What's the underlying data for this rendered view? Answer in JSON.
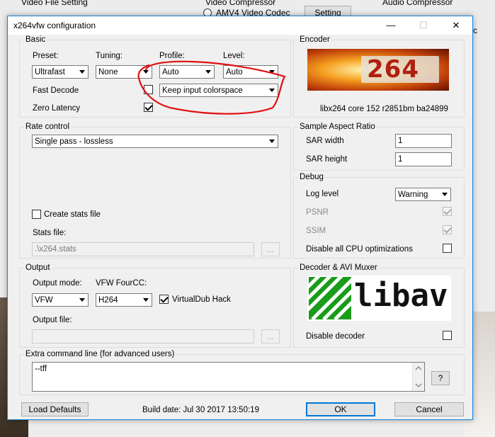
{
  "background": {
    "snippet_1": "Video File Setting",
    "snippet_2": "Video Compressor",
    "snippet_3": "AMV4 Video Codec",
    "snippet_4": "Setting",
    "snippet_5": "Audio Compressor",
    "snippet_6": "c"
  },
  "window": {
    "title": "x264vfw configuration",
    "minimize": "—",
    "maximize": "☐",
    "close": "✕"
  },
  "basic": {
    "group_label": "Basic",
    "preset_label": "Preset:",
    "preset_value": "Ultrafast",
    "tuning_label": "Tuning:",
    "tuning_value": "None",
    "profile_label": "Profile:",
    "profile_value": "Auto",
    "level_label": "Level:",
    "level_value": "Auto",
    "fast_decode_label": "Fast Decode",
    "fast_decode_checked": false,
    "colorspace_value": "Keep input colorspace",
    "zero_latency_label": "Zero Latency",
    "zero_latency_checked": true
  },
  "encoder": {
    "group_label": "Encoder",
    "logo_text": "264",
    "version_text": "libx264 core 152 r2851bm ba24899"
  },
  "rate_control": {
    "group_label": "Rate control",
    "mode_value": "Single pass - lossless",
    "create_stats_label": "Create stats file",
    "create_stats_checked": false,
    "stats_file_label": "Stats file:",
    "stats_file_value": ".\\x264.stats",
    "browse_label": "..."
  },
  "sar": {
    "group_label": "Sample Aspect Ratio",
    "width_label": "SAR width",
    "width_value": "1",
    "height_label": "SAR height",
    "height_value": "1"
  },
  "debug": {
    "group_label": "Debug",
    "log_level_label": "Log level",
    "log_level_value": "Warning",
    "psnr_label": "PSNR",
    "psnr_checked": true,
    "ssim_label": "SSIM",
    "ssim_checked": true,
    "disable_cpu_label": "Disable all CPU optimizations",
    "disable_cpu_checked": false
  },
  "output": {
    "group_label": "Output",
    "mode_label": "Output mode:",
    "mode_value": "VFW",
    "fourcc_label": "VFW FourCC:",
    "fourcc_value": "H264",
    "vdub_label": "VirtualDub Hack",
    "vdub_checked": true,
    "file_label": "Output file:",
    "file_value": "",
    "browse_label": "..."
  },
  "decoder": {
    "group_label": "Decoder & AVI Muxer",
    "logo_text": "libav",
    "disable_decoder_label": "Disable decoder",
    "disable_decoder_checked": false
  },
  "extra": {
    "group_label": "Extra command line (for advanced users)",
    "value": "--tff",
    "help_label": "?"
  },
  "footer": {
    "load_defaults": "Load Defaults",
    "build_date": "Build date: Jul 30 2017 13:50:19",
    "ok": "OK",
    "cancel": "Cancel"
  },
  "colors": {
    "annotation": "#e01010",
    "libav_green": "#1a9c1a",
    "logo_orange": "#e07010",
    "accent": "#0078d7"
  }
}
